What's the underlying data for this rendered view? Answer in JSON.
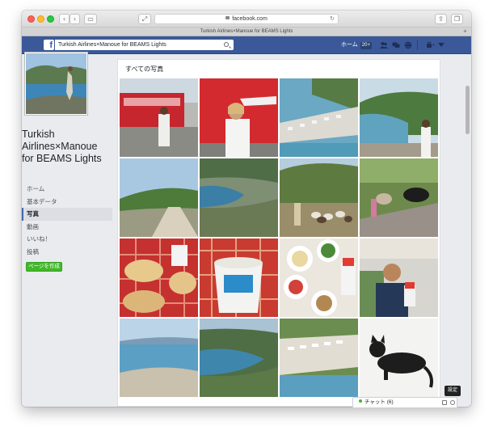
{
  "browser": {
    "address": "facebook.com",
    "tab_title": "Turkish Airlines×Manoue for BEAMS Lights"
  },
  "fb_bar": {
    "search_value": "Turkish Airlines×Manoue for BEAMS Lights",
    "home_label": "ホーム",
    "home_count": "20+"
  },
  "page": {
    "title": "Turkish Airlines×Manoue for BEAMS Lights"
  },
  "nav": {
    "items": [
      {
        "label": "ホーム"
      },
      {
        "label": "基本データ"
      },
      {
        "label": "写真"
      },
      {
        "label": "動画"
      },
      {
        "label": "いいね！"
      },
      {
        "label": "投稿"
      }
    ],
    "active_index": 2
  },
  "create_page_label": "ページを作成",
  "photos": {
    "section_title": "すべての写真",
    "count": 16
  },
  "chat": {
    "label": "チャット (6)"
  },
  "tooltip": "設定",
  "colors": {
    "facebook_blue": "#3b5998",
    "create_green": "#42b72a"
  }
}
